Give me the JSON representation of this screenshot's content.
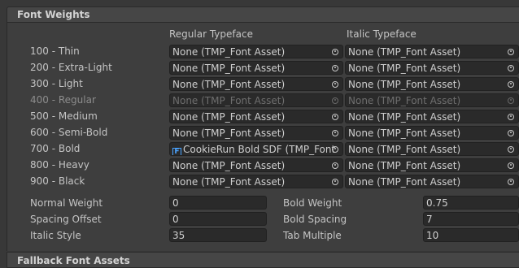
{
  "section": {
    "title": "Font Weights"
  },
  "columns": {
    "regular": "Regular Typeface",
    "italic": "Italic Typeface"
  },
  "rows": [
    {
      "label": "100 - Thin",
      "regular": "None (TMP_Font Asset)",
      "italic": "None (TMP_Font Asset)",
      "disabled": false
    },
    {
      "label": "200 - Extra-Light",
      "regular": "None (TMP_Font Asset)",
      "italic": "None (TMP_Font Asset)",
      "disabled": false
    },
    {
      "label": "300 - Light",
      "regular": "None (TMP_Font Asset)",
      "italic": "None (TMP_Font Asset)",
      "disabled": false
    },
    {
      "label": "400 - Regular",
      "regular": "None (TMP_Font Asset)",
      "italic": "None (TMP_Font Asset)",
      "disabled": true
    },
    {
      "label": "500 - Medium",
      "regular": "None (TMP_Font Asset)",
      "italic": "None (TMP_Font Asset)",
      "disabled": false
    },
    {
      "label": "600 - Semi-Bold",
      "regular": "None (TMP_Font Asset)",
      "italic": "None (TMP_Font Asset)",
      "disabled": false
    },
    {
      "label": "700 - Bold",
      "regular": "CookieRun Bold SDF (TMP_Font",
      "italic": "None (TMP_Font Asset)",
      "disabled": false,
      "regular_icon": "font-asset-icon"
    },
    {
      "label": "800 - Heavy",
      "regular": "None (TMP_Font Asset)",
      "italic": "None (TMP_Font Asset)",
      "disabled": false
    },
    {
      "label": "900 - Black",
      "regular": "None (TMP_Font Asset)",
      "italic": "None (TMP_Font Asset)",
      "disabled": false
    }
  ],
  "settings": {
    "normal_weight_label": "Normal Weight",
    "normal_weight": "0",
    "spacing_offset_label": "Spacing Offset",
    "spacing_offset": "0",
    "italic_style_label": "Italic Style",
    "italic_style": "35",
    "bold_weight_label": "Bold Weight",
    "bold_weight": "0.75",
    "bold_spacing_label": "Bold Spacing",
    "bold_spacing": "7",
    "tab_multiple_label": "Tab Multiple",
    "tab_multiple": "10"
  },
  "fallback": {
    "title": "Fallback Font Assets"
  },
  "icons": {
    "picker": "object-picker-icon",
    "asset": "font-asset-icon"
  },
  "colors": {
    "background": "#383838",
    "field": "#2a2a2a",
    "asset_icon": "#4aa3ff"
  }
}
